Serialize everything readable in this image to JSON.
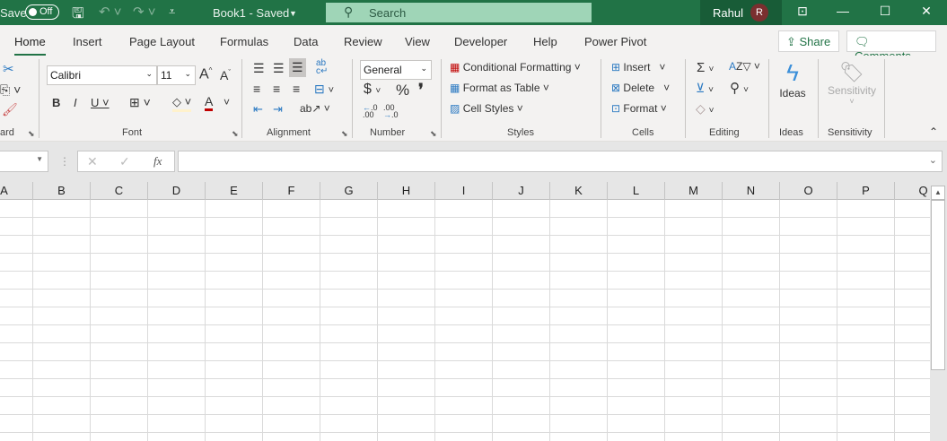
{
  "titlebar": {
    "autosave_label": "Save",
    "autosave_state": "Off",
    "doc_title": "Book1  -  Saved",
    "search_placeholder": "Search",
    "user_name": "Rahul",
    "user_initial": "R"
  },
  "tabs": [
    "Home",
    "Insert",
    "Page Layout",
    "Formulas",
    "Data",
    "Review",
    "View",
    "Developer",
    "Help",
    "Power Pivot"
  ],
  "share_label": "Share",
  "comments_label": "Comments",
  "ribbon": {
    "groups": {
      "clipboard": "ard",
      "font": "Font",
      "alignment": "Alignment",
      "number": "Number",
      "styles": "Styles",
      "cells": "Cells",
      "editing": "Editing",
      "ideas": "Ideas",
      "sensitivity": "Sensitivity"
    },
    "font_name": "Calibri",
    "font_size": "11",
    "number_format": "General",
    "styles": {
      "conditional": "Conditional Formatting",
      "table": "Format as Table",
      "cell_styles": "Cell Styles"
    },
    "cells": {
      "insert": "Insert",
      "delete": "Delete",
      "format": "Format"
    },
    "ideas_label": "Ideas",
    "sensitivity_label": "Sensitivity"
  },
  "formula_bar": {
    "name_box": "",
    "formula": "",
    "fx": "fx"
  },
  "columns": [
    "A",
    "B",
    "C",
    "D",
    "E",
    "F",
    "G",
    "H",
    "I",
    "J",
    "K",
    "L",
    "M",
    "N",
    "O",
    "P",
    "Q"
  ],
  "colors": {
    "accent": "#217346",
    "font_color": "#c00000",
    "fill_color": "#fff2cc"
  }
}
